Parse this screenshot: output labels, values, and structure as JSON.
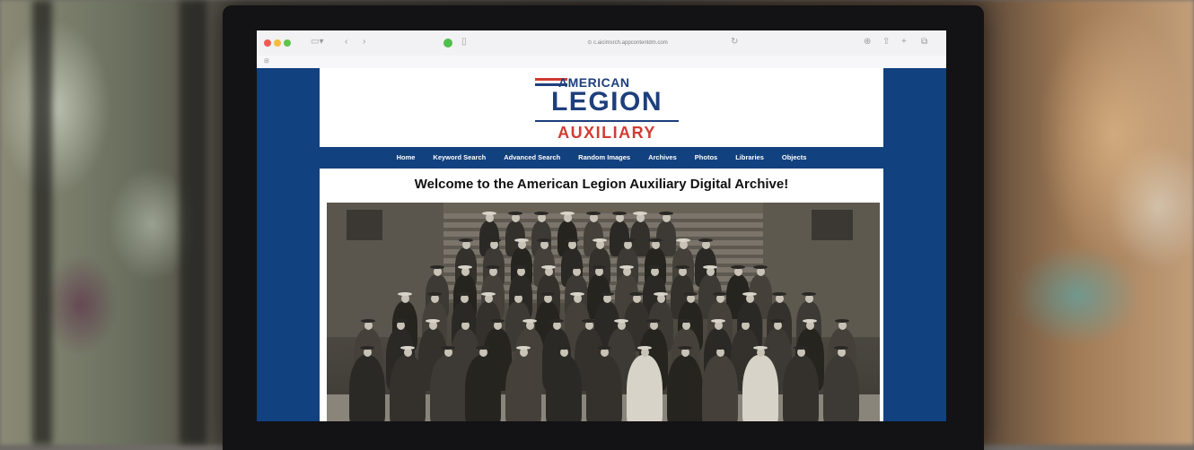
{
  "browser": {
    "url": "⊙ c.aicimsrch.appcontentdm.com",
    "icons": {
      "sidebar": "sidebar-icon",
      "back": "chevron-left-icon",
      "forward": "chevron-right-icon",
      "reload": "reload-icon",
      "share": "share-icon",
      "new_tab": "plus-icon",
      "tabs": "tabs-overview-icon",
      "download": "download-icon"
    },
    "favorites_glyph": "⊞"
  },
  "site": {
    "logo": {
      "top": "AMERICAN",
      "middle": "LEGION",
      "bottom": "AUXILIARY"
    },
    "nav": [
      "Home",
      "Keyword Search",
      "Advanced Search",
      "Random Images",
      "Archives",
      "Photos",
      "Libraries",
      "Objects"
    ],
    "welcome": "Welcome to the American Legion Auxiliary Digital Archive!",
    "colors": {
      "brand_blue": "#12417f",
      "brand_red": "#d13c33"
    }
  }
}
